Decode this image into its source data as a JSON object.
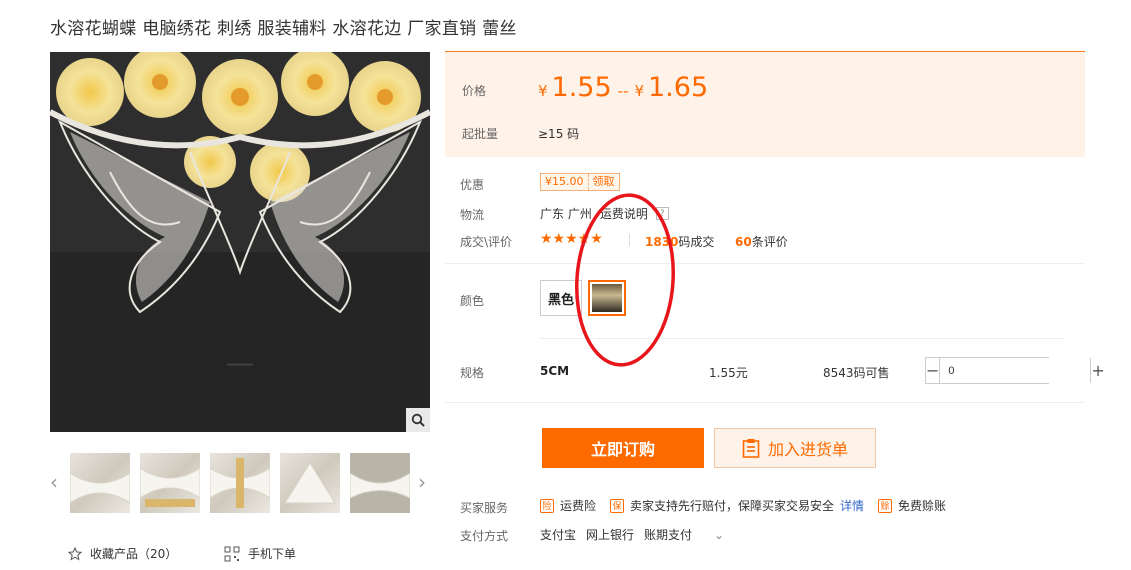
{
  "title": "水溶花蝴蝶 电脑绣花 刺绣 服装辅料 水溶花边 厂家直销 蕾丝",
  "price": {
    "label": "价格",
    "currency": "¥",
    "min": "1.55",
    "separator": "--",
    "max": "1.65",
    "moq_label": "起批量",
    "moq": "≥15 码",
    "accent_color": "#ff6a00"
  },
  "coupon": {
    "label": "优惠",
    "amount": "¥15.00",
    "action": "领取"
  },
  "logistics": {
    "label": "物流",
    "origin": "广东 广州",
    "shipping_info": "运费说明",
    "help": "?"
  },
  "deals": {
    "label": "成交\\评价",
    "stars": "★★★★★",
    "count": "1830",
    "count_suffix": "码成交",
    "reviews": "60",
    "reviews_suffix": "条评价"
  },
  "color": {
    "label": "颜色",
    "option": "黑色"
  },
  "spec": {
    "label": "规格",
    "name": "5CM",
    "price": "1.55元",
    "stock": "8543码可售",
    "qty": "0",
    "minus": "−",
    "plus": "+"
  },
  "actions": {
    "buy": "立即订购",
    "cart": "加入进货单"
  },
  "services": {
    "label": "买家服务",
    "items": [
      "运费险",
      "卖家支持先行赔付，保障买家交易安全",
      "免费赊账"
    ],
    "link": "详情"
  },
  "payment": {
    "label": "支付方式",
    "methods": [
      "支付宝",
      "网上银行",
      "账期支付"
    ]
  },
  "gallery": {
    "prev": "‹",
    "next": "›"
  },
  "bottom": {
    "favorite": "收藏产品（20）",
    "mobile_order": "手机下单"
  },
  "icons": {
    "zoom": "search-icon",
    "star": "star-icon",
    "qr": "qr-code-icon",
    "cart": "clipboard-icon"
  }
}
